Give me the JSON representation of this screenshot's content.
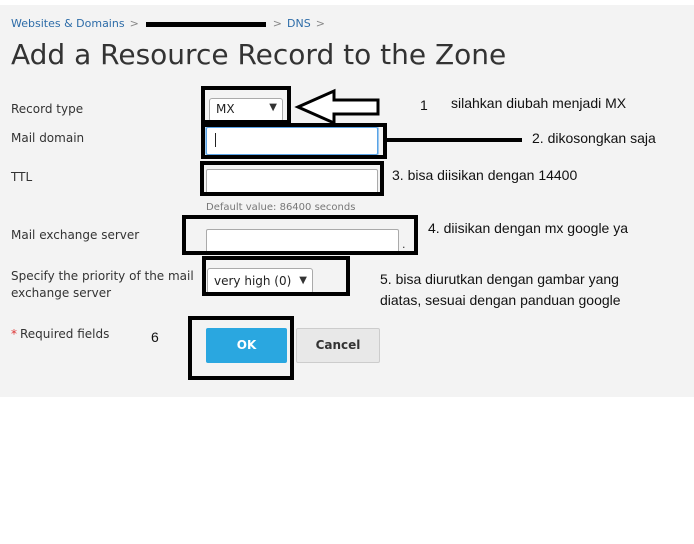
{
  "breadcrumb": {
    "item1": "Websites & Domains",
    "item3": "DNS",
    "separator": ">"
  },
  "page_title": "Add a Resource Record to the Zone",
  "form": {
    "record_type": {
      "label": "Record type",
      "value": "MX"
    },
    "mail_domain": {
      "label": "Mail domain",
      "value": ""
    },
    "ttl": {
      "label": "TTL",
      "value": "",
      "hint": "Default value: 86400 seconds"
    },
    "mail_exchange_server": {
      "label": "Mail exchange server",
      "value": "",
      "suffix": "."
    },
    "priority": {
      "label_line1": "Specify the priority of the mail",
      "label_line2": "exchange server",
      "value": "very high (0)"
    },
    "required_note": "Required fields",
    "required_mark": "*",
    "ok_label": "OK",
    "cancel_label": "Cancel"
  },
  "annotations": {
    "n1": "1",
    "a1": "silahkan diubah menjadi MX",
    "a2": "2. dikosongkan saja",
    "a3": "3. bisa diisikan dengan 14400",
    "a4": "4. diisikan dengan mx google ya",
    "a5_line1": "5. bisa diurutkan dengan gambar yang",
    "a5_line2": "diatas, sesuai dengan panduan google",
    "n6": "6"
  },
  "icons": {
    "arrow": "left-arrow-icon",
    "chevron": "chevron-down-icon"
  }
}
